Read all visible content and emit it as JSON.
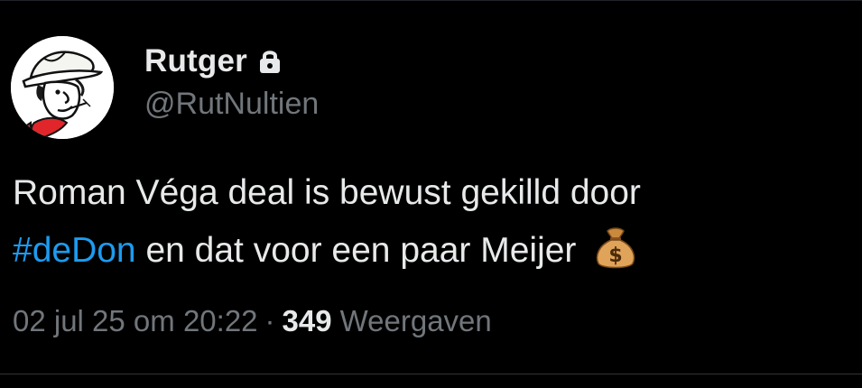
{
  "author": {
    "display_name": "Rutger",
    "handle": "@RutNultien",
    "protected": true,
    "avatar": "lucky-luke-cartoon-avatar"
  },
  "tweet": {
    "text_line1": "Roman Véga deal is bewust gekilld door",
    "hashtag": "#deDon",
    "text_line2_rest": " en dat voor een paar Meijer ",
    "emoji": "money-bag-emoji"
  },
  "meta": {
    "timestamp": "02 jul 25 om 20:22",
    "separator": "·",
    "views_count": "349",
    "views_label": "Weergaven"
  },
  "colors": {
    "background": "#000000",
    "text_primary": "#e7e9ea",
    "text_secondary": "#71767b",
    "link": "#1d9bf0",
    "divider": "#2f3336"
  }
}
